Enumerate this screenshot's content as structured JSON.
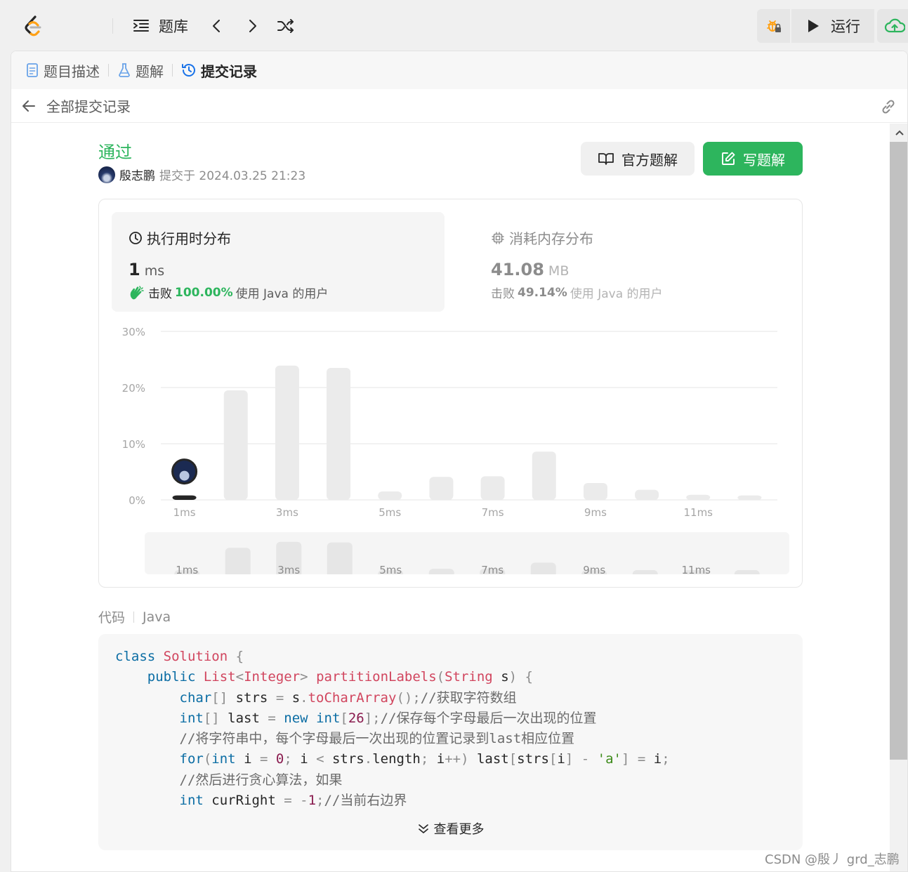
{
  "topbar": {
    "problem_bank_label": "题库",
    "run_label": "运行"
  },
  "tabs": [
    {
      "label": "题目描述",
      "icon": "document-icon"
    },
    {
      "label": "题解",
      "icon": "flask-icon"
    },
    {
      "label": "提交记录",
      "icon": "history-icon",
      "active": true
    }
  ],
  "subheader": {
    "back_label": "全部提交记录"
  },
  "submission": {
    "status": "通过",
    "author": "殷志鹏",
    "submitted_at": "提交于 2024.03.25 21:23",
    "official_solution_label": "官方题解",
    "write_solution_label": "写题解"
  },
  "runtime": {
    "title": "执行用时分布",
    "value": "1",
    "unit": "ms",
    "beat_prefix": "击败",
    "beat_percent": "100.00%",
    "beat_suffix": "使用 Java 的用户"
  },
  "memory": {
    "title": "消耗内存分布",
    "value": "41.08",
    "unit": "MB",
    "beat_prefix": "击败",
    "beat_percent": "49.14%",
    "beat_suffix": "使用 Java 的用户"
  },
  "chart_data": {
    "type": "bar",
    "categories": [
      "1ms",
      "2ms",
      "3ms",
      "4ms",
      "5ms",
      "6ms",
      "7ms",
      "8ms",
      "9ms",
      "10ms",
      "11ms",
      "12ms"
    ],
    "values": [
      0.8,
      19.5,
      23.9,
      23.5,
      1.5,
      4.1,
      4.2,
      8.6,
      3.0,
      1.8,
      0.9,
      0.8
    ],
    "x_tick_labels": [
      "1ms",
      "3ms",
      "5ms",
      "7ms",
      "9ms",
      "11ms"
    ],
    "y_tick_labels": [
      "30%",
      "20%",
      "10%",
      "0%"
    ],
    "ylim": [
      0,
      30
    ],
    "grid": true,
    "highlight_category": "1ms",
    "bar_color": "#ebebeb",
    "highlight_color": "#262626",
    "brush_labels": [
      "1ms",
      "3ms",
      "5ms",
      "7ms",
      "9ms",
      "11ms"
    ]
  },
  "code": {
    "label": "代码",
    "language": "Java",
    "show_more_label": "查看更多"
  },
  "watermark": "CSDN @殷丿 grd_志鹏",
  "colors": {
    "accent_green": "#2db55d",
    "text": "#262626",
    "muted": "#8c8c8c"
  }
}
